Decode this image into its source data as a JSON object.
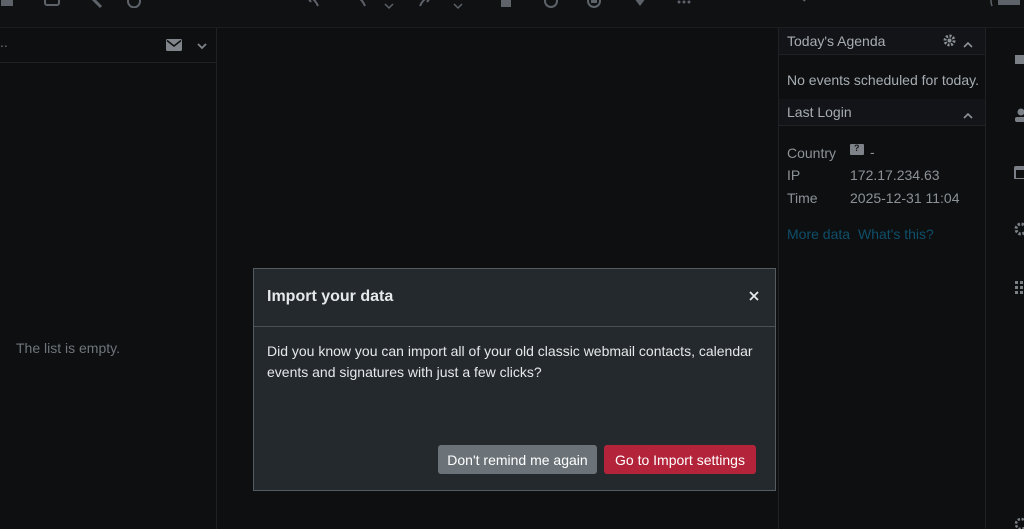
{
  "list": {
    "header_ellipsis": "..",
    "empty_text": "The list is empty."
  },
  "agenda": {
    "title": "Today's Agenda",
    "no_events": "No events scheduled for today."
  },
  "last_login": {
    "title": "Last Login",
    "country_label": "Country",
    "country_flag": "?",
    "country_value": "-",
    "ip_label": "IP",
    "ip_value": "172.17.234.63",
    "time_label": "Time",
    "time_value": "2025-12-31 11:04",
    "more_data_link": "More data",
    "whats_this_link": "What's this?"
  },
  "modal": {
    "title": "Import your data",
    "body": "Did you know you can import all of your old classic webmail contacts, calendar events and signatures with just a few clicks?",
    "secondary_button": "Don't remind me again",
    "primary_button": "Go to Import settings"
  },
  "colors": {
    "primary_button": "#b3243b",
    "secondary_button": "#6b7378",
    "link": "#0f4f6a",
    "modal_bg": "#23292c"
  }
}
